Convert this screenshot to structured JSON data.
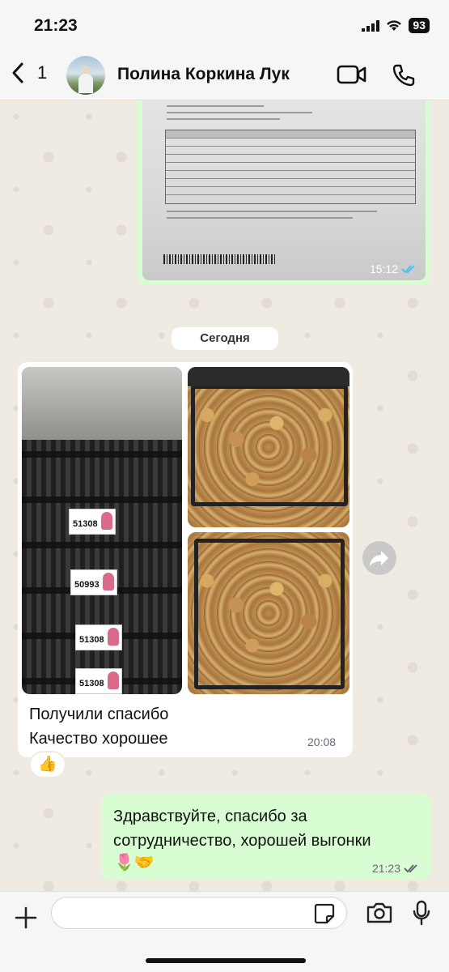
{
  "status_bar": {
    "time": "21:23",
    "battery": "93"
  },
  "header": {
    "back_label": "<",
    "unread_count": "1",
    "contact_name": "Полина Коркина Лук",
    "icons": [
      "video-call-icon",
      "phone-icon"
    ]
  },
  "messages": {
    "doc_photo": {
      "time": "15:12"
    },
    "date_divider": "Сегодня",
    "photo_group": {
      "crate_labels": [
        "51308",
        "50993",
        "51308",
        "51308"
      ],
      "text_line1": "Получили спасибо",
      "text_line2": "Качество хорошее",
      "time": "20:08",
      "reaction": "👍"
    },
    "outgoing": {
      "text": "Здравствуйте, спасибо за сотрудничество, хорошей выгонки",
      "emojis": "🌷🤝",
      "time": "21:23"
    }
  },
  "input": {
    "placeholder": ""
  },
  "colors": {
    "outgoing_bubble": "#d9fdd3",
    "incoming_bubble": "#ffffff",
    "chat_bg": "#efeae2",
    "read_ticks": "#53bdeb"
  }
}
